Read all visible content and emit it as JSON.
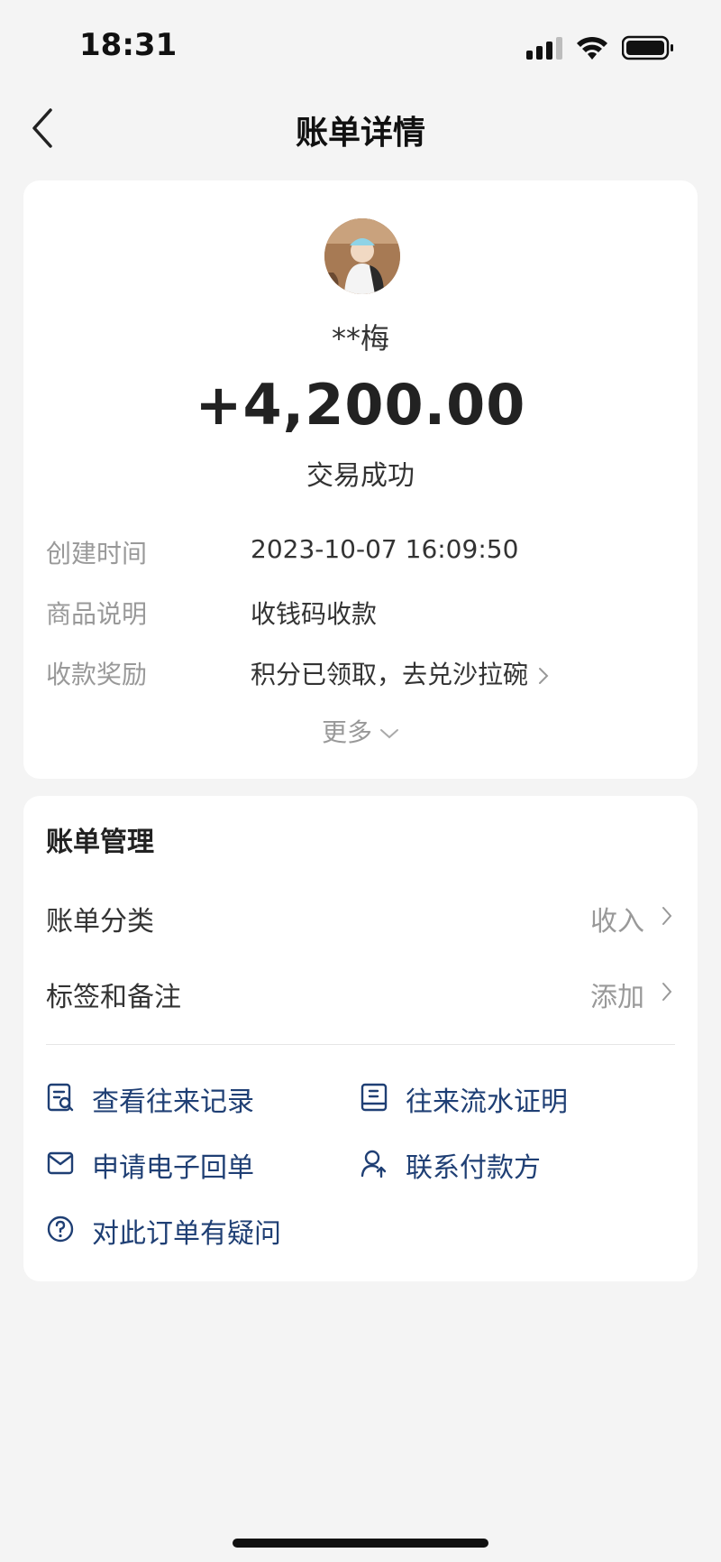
{
  "status_bar": {
    "time": "18:31"
  },
  "header": {
    "title": "账单详情"
  },
  "transaction": {
    "payer": "**梅",
    "amount": "+4,200.00",
    "status": "交易成功",
    "details": [
      {
        "label": "创建时间",
        "value": "2023-10-07 16:09:50"
      },
      {
        "label": "商品说明",
        "value": "收钱码收款"
      },
      {
        "label": "收款奖励",
        "value": "积分已领取，去兑沙拉碗"
      }
    ],
    "more_label": "更多"
  },
  "management": {
    "title": "账单管理",
    "rows": [
      {
        "label": "账单分类",
        "value": "收入"
      },
      {
        "label": "标签和备注",
        "value": "添加"
      }
    ],
    "actions": [
      {
        "label": "查看往来记录",
        "icon": "record-search-icon"
      },
      {
        "label": "往来流水证明",
        "icon": "document-icon"
      },
      {
        "label": "申请电子回单",
        "icon": "envelope-icon"
      },
      {
        "label": "联系付款方",
        "icon": "contact-person-icon"
      },
      {
        "label": "对此订单有疑问",
        "icon": "question-circle-icon"
      }
    ]
  },
  "colors": {
    "accent_link": "#1f3f74",
    "muted": "#999999",
    "background": "#f4f4f4"
  }
}
